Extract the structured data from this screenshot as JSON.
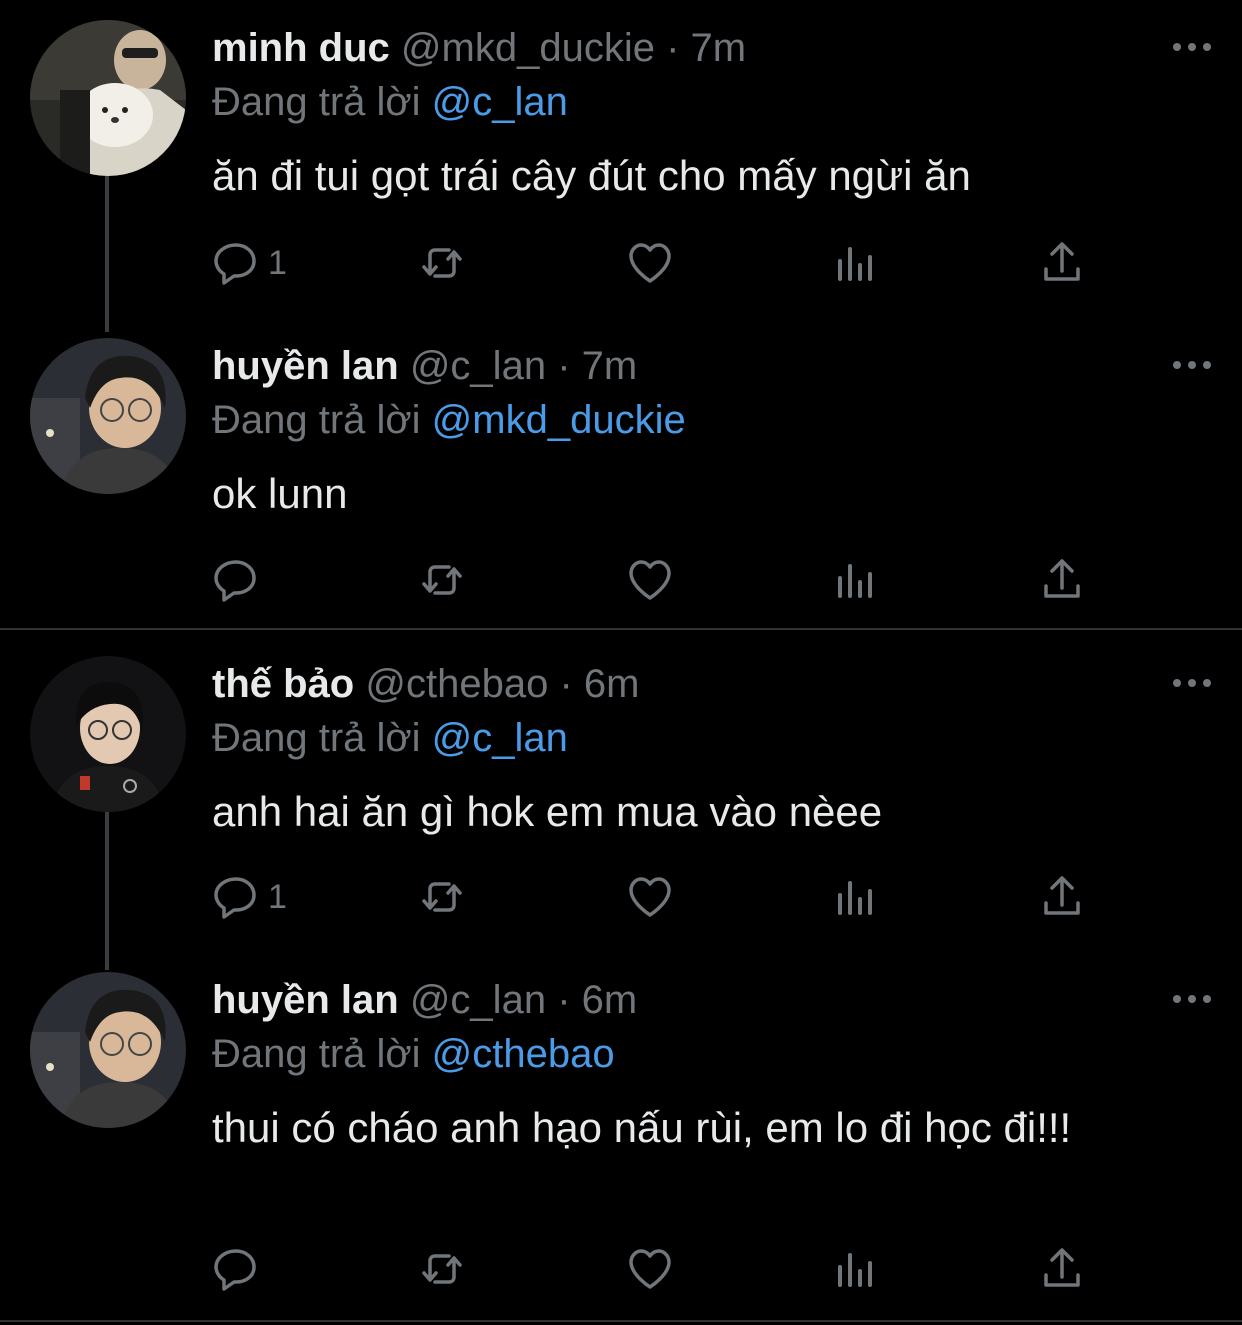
{
  "labels": {
    "replying_prefix": "Đang trả lời",
    "dot": "·"
  },
  "tweets": [
    {
      "name": "minh duc",
      "handle": "@mkd_duckie",
      "time": "7m",
      "reply_to": "@c_lan",
      "text": "ăn đi tui gọt trái cây đút cho mấy ngừi ăn",
      "reply_count": "1",
      "avatar": "dog-avatar"
    },
    {
      "name": "huyền lan",
      "handle": "@c_lan",
      "time": "7m",
      "reply_to": "@mkd_duckie",
      "text": "ok lunn",
      "reply_count": "",
      "avatar": "man-glasses-avatar"
    },
    {
      "name": "thế bảo",
      "handle": "@cthebao",
      "time": "6m",
      "reply_to": "@c_lan",
      "text": "anh hai ăn gì hok em mua vào nèee",
      "reply_count": "1",
      "avatar": "man-jersey-avatar"
    },
    {
      "name": "huyền lan",
      "handle": "@c_lan",
      "time": "6m",
      "reply_to": "@cthebao",
      "text": "thui có cháo anh hạo nấu rùi, em lo đi học đi!!!",
      "reply_count": "",
      "avatar": "man-glasses-avatar"
    }
  ],
  "colors": {
    "background": "#000000",
    "primary_text": "#e7e9ea",
    "secondary_text": "#71767b",
    "mention": "#4a9ce8",
    "divider": "#2f3336"
  }
}
